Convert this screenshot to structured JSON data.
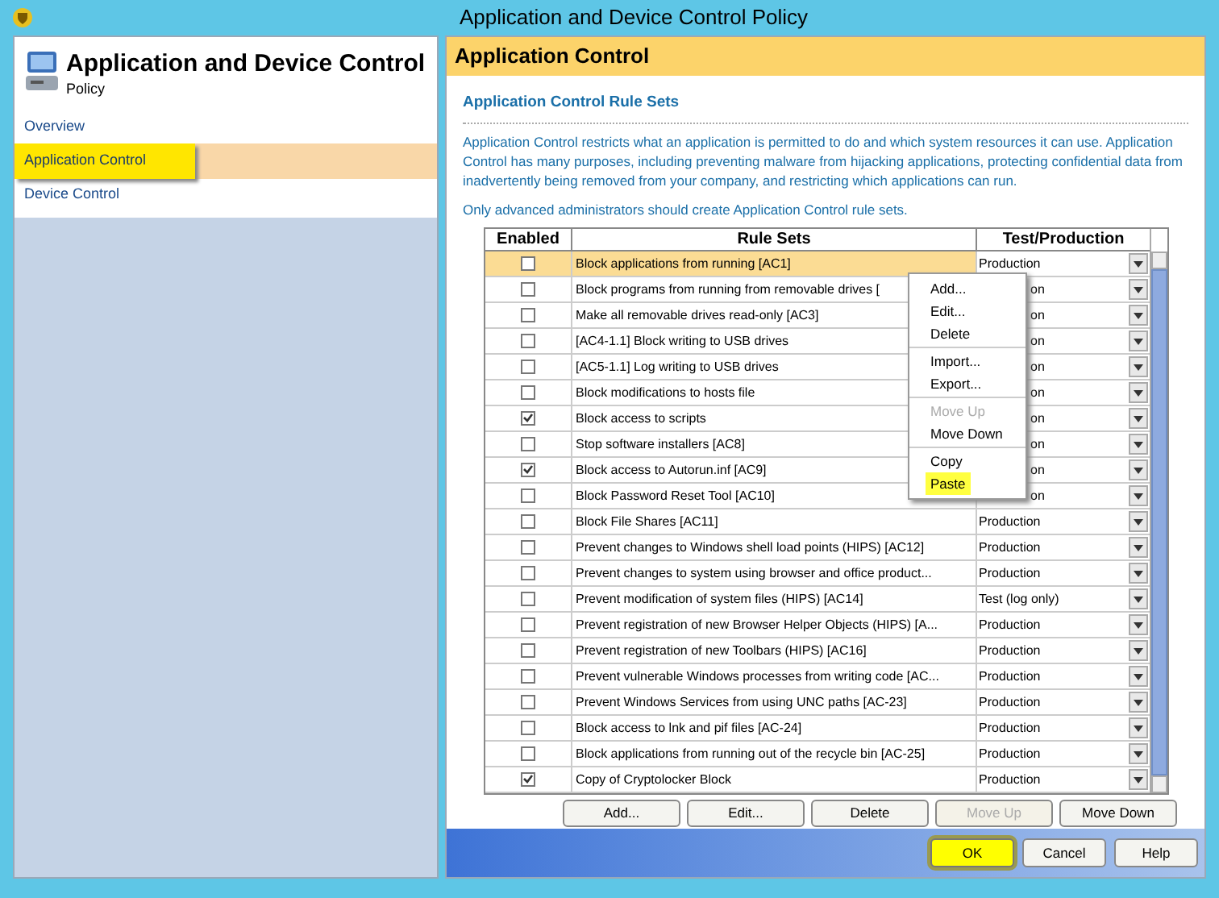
{
  "window": {
    "title": "Application and Device Control Policy"
  },
  "sidebar": {
    "title": "Application and Device Control",
    "subtitle": "Policy",
    "items": [
      {
        "label": "Overview",
        "selected": false
      },
      {
        "label": "Application Control",
        "selected": true
      },
      {
        "label": "Device Control",
        "selected": false
      }
    ]
  },
  "panel": {
    "title": "Application Control",
    "section": "Application Control Rule Sets",
    "description": "Application Control restricts what an application is permitted to do and which system resources it can use. Application Control has many purposes, including preventing malware from hijacking applications, protecting confidential data from inadvertently being removed from your company, and restricting which applications can run.",
    "note": "Only advanced administrators should create Application Control rule sets."
  },
  "table": {
    "columns": [
      "Enabled",
      "Rule Sets",
      "Test/Production"
    ],
    "rows": [
      {
        "enabled": false,
        "selected": true,
        "rule": "Block applications from running [AC1]",
        "mode": "Production"
      },
      {
        "enabled": false,
        "selected": false,
        "rule": "Block programs from running from removable drives [",
        "mode": "on"
      },
      {
        "enabled": false,
        "selected": false,
        "rule": "Make all removable drives read-only [AC3]",
        "mode": "on"
      },
      {
        "enabled": false,
        "selected": false,
        "rule": "[AC4-1.1] Block writing to USB drives",
        "mode": "on"
      },
      {
        "enabled": false,
        "selected": false,
        "rule": "[AC5-1.1] Log writing to USB drives",
        "mode": "on"
      },
      {
        "enabled": false,
        "selected": false,
        "rule": "Block modifications to hosts file",
        "mode": "on"
      },
      {
        "enabled": true,
        "selected": false,
        "rule": "Block access to scripts",
        "mode": "on"
      },
      {
        "enabled": false,
        "selected": false,
        "rule": "Stop software installers [AC8]",
        "mode": "on"
      },
      {
        "enabled": true,
        "selected": false,
        "rule": "Block access to Autorun.inf [AC9]",
        "mode": "on"
      },
      {
        "enabled": false,
        "selected": false,
        "rule": "Block Password Reset Tool [AC10]",
        "mode": "on"
      },
      {
        "enabled": false,
        "selected": false,
        "rule": "Block File Shares [AC11]",
        "mode": "Production"
      },
      {
        "enabled": false,
        "selected": false,
        "rule": "Prevent changes to Windows shell load points (HIPS) [AC12]",
        "mode": "Production"
      },
      {
        "enabled": false,
        "selected": false,
        "rule": "Prevent changes to system using browser and office product...",
        "mode": "Production"
      },
      {
        "enabled": false,
        "selected": false,
        "rule": "Prevent modification of system files (HIPS) [AC14]",
        "mode": "Test (log only)"
      },
      {
        "enabled": false,
        "selected": false,
        "rule": "Prevent registration of new Browser Helper Objects (HIPS) [A...",
        "mode": "Production"
      },
      {
        "enabled": false,
        "selected": false,
        "rule": "Prevent registration of new Toolbars (HIPS) [AC16]",
        "mode": "Production"
      },
      {
        "enabled": false,
        "selected": false,
        "rule": "Prevent vulnerable Windows processes from writing code [AC...",
        "mode": "Production"
      },
      {
        "enabled": false,
        "selected": false,
        "rule": "Prevent Windows Services from using UNC paths [AC-23]",
        "mode": "Production"
      },
      {
        "enabled": false,
        "selected": false,
        "rule": "Block access to lnk and pif files [AC-24]",
        "mode": "Production"
      },
      {
        "enabled": false,
        "selected": false,
        "rule": "Block applications from running out of the recycle bin [AC-25]",
        "mode": "Production"
      },
      {
        "enabled": true,
        "selected": false,
        "rule": "Copy of Cryptolocker Block",
        "mode": "Production"
      }
    ]
  },
  "context_menu": [
    [
      {
        "label": "Add...",
        "disabled": false,
        "selected": false
      },
      {
        "label": "Edit...",
        "disabled": false,
        "selected": false
      },
      {
        "label": "Delete",
        "disabled": false,
        "selected": false
      }
    ],
    [
      {
        "label": "Import...",
        "disabled": false,
        "selected": false
      },
      {
        "label": "Export...",
        "disabled": false,
        "selected": false
      }
    ],
    [
      {
        "label": "Move Up",
        "disabled": true,
        "selected": false
      },
      {
        "label": "Move Down",
        "disabled": false,
        "selected": false
      }
    ],
    [
      {
        "label": "Copy",
        "disabled": false,
        "selected": false
      },
      {
        "label": "Paste",
        "disabled": false,
        "selected": true
      }
    ]
  ],
  "table_buttons": [
    {
      "label": "Add...",
      "disabled": false
    },
    {
      "label": "Edit...",
      "disabled": false
    },
    {
      "label": "Delete",
      "disabled": false
    },
    {
      "label": "Move Up",
      "disabled": true
    },
    {
      "label": "Move Down",
      "disabled": false
    }
  ],
  "dialog_buttons": [
    {
      "label": "OK",
      "selected": true
    },
    {
      "label": "Cancel",
      "selected": false
    },
    {
      "label": "Help",
      "selected": false
    }
  ]
}
